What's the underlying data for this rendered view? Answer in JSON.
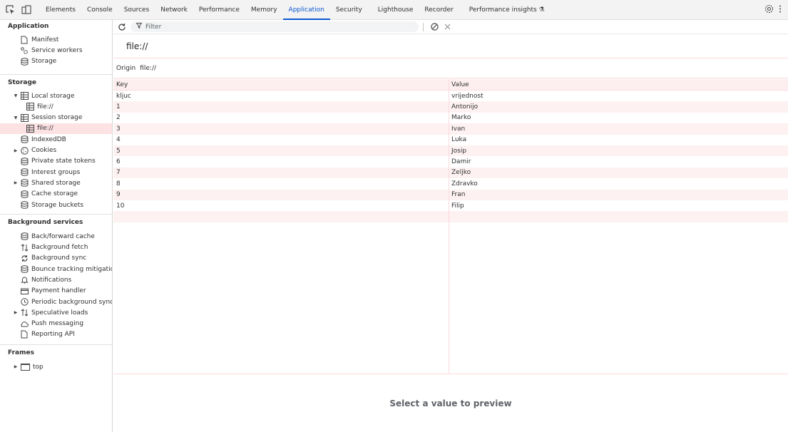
{
  "toolbar": {
    "tabs": [
      {
        "label": "Elements"
      },
      {
        "label": "Console"
      },
      {
        "label": "Sources"
      },
      {
        "label": "Network"
      },
      {
        "label": "Performance"
      },
      {
        "label": "Memory"
      },
      {
        "label": "Application",
        "active": true
      },
      {
        "label": "Security"
      },
      {
        "label": "Lighthouse"
      },
      {
        "label": "Recorder"
      },
      {
        "label": "Performance insights ⚗"
      }
    ]
  },
  "sidebar": {
    "application": {
      "title": "Application",
      "items": [
        {
          "label": "Manifest",
          "icon": "document-icon"
        },
        {
          "label": "Service workers",
          "icon": "gears-icon"
        },
        {
          "label": "Storage",
          "icon": "database-icon"
        }
      ]
    },
    "storage": {
      "title": "Storage",
      "items": [
        {
          "label": "Local storage",
          "icon": "table-icon"
        },
        {
          "label": "file://",
          "icon": "table-icon"
        },
        {
          "label": "Session storage",
          "icon": "table-icon"
        },
        {
          "label": "file://",
          "icon": "table-icon"
        },
        {
          "label": "IndexedDB",
          "icon": "database-icon"
        },
        {
          "label": "Cookies",
          "icon": "cookie-icon"
        },
        {
          "label": "Private state tokens",
          "icon": "database-icon"
        },
        {
          "label": "Interest groups",
          "icon": "database-icon"
        },
        {
          "label": "Shared storage",
          "icon": "database-icon"
        },
        {
          "label": "Cache storage",
          "icon": "database-icon"
        },
        {
          "label": "Storage buckets",
          "icon": "database-icon"
        }
      ]
    },
    "background": {
      "title": "Background services",
      "items": [
        {
          "label": "Back/forward cache",
          "icon": "database-icon"
        },
        {
          "label": "Background fetch",
          "icon": "fetch-arrows-icon"
        },
        {
          "label": "Background sync",
          "icon": "sync-icon"
        },
        {
          "label": "Bounce tracking mitigations",
          "icon": "database-icon"
        },
        {
          "label": "Notifications",
          "icon": "bell-icon"
        },
        {
          "label": "Payment handler",
          "icon": "card-icon"
        },
        {
          "label": "Periodic background sync",
          "icon": "clock-icon"
        },
        {
          "label": "Speculative loads",
          "icon": "fetch-arrows-icon"
        },
        {
          "label": "Push messaging",
          "icon": "cloud-icon"
        },
        {
          "label": "Reporting API",
          "icon": "document-icon"
        }
      ]
    },
    "frames": {
      "title": "Frames",
      "items": [
        {
          "label": "top",
          "icon": "window-icon"
        }
      ]
    }
  },
  "main": {
    "filter_placeholder": "Filter",
    "origin_heading": "file://",
    "origin_label": "Origin",
    "origin_value": "file://",
    "columns": {
      "key": "Key",
      "value": "Value"
    },
    "rows": [
      {
        "key": "kljuc",
        "value": "vrijednost"
      },
      {
        "key": "1",
        "value": "Antonijo"
      },
      {
        "key": "2",
        "value": "Marko"
      },
      {
        "key": "3",
        "value": "Ivan"
      },
      {
        "key": "4",
        "value": "Luka"
      },
      {
        "key": "5",
        "value": "Josip"
      },
      {
        "key": "6",
        "value": "Damir"
      },
      {
        "key": "7",
        "value": "Željko"
      },
      {
        "key": "8",
        "value": "Zdravko"
      },
      {
        "key": "9",
        "value": "Fran"
      },
      {
        "key": "10",
        "value": "Filip"
      }
    ],
    "preview_text": "Select a value to preview"
  }
}
